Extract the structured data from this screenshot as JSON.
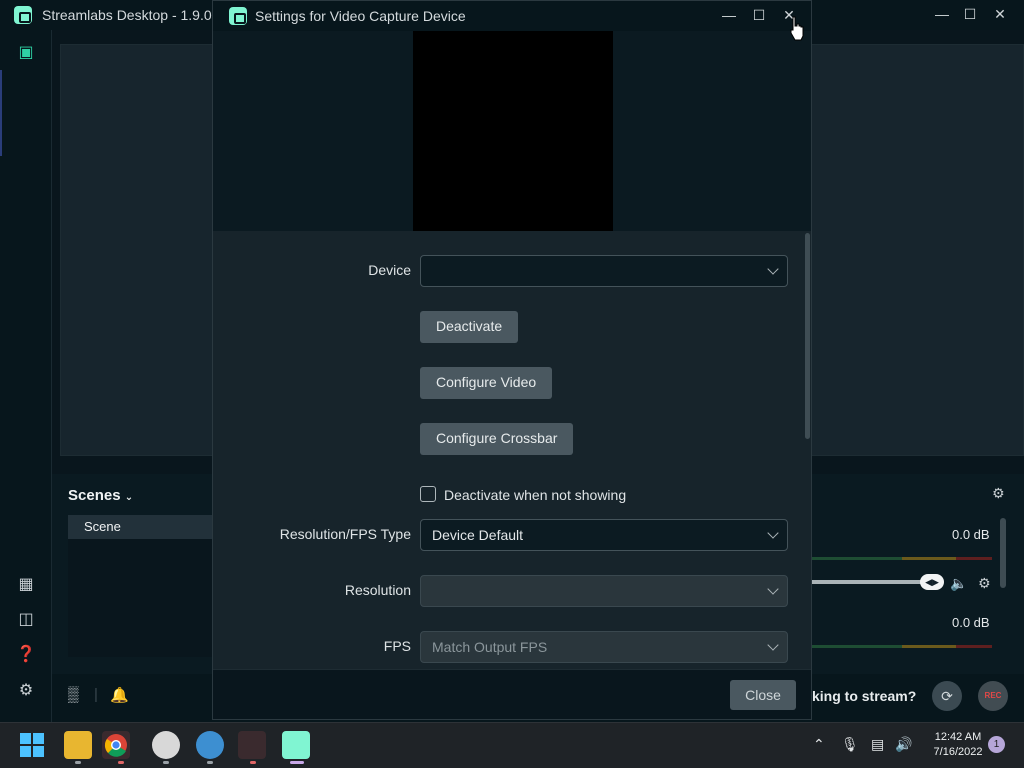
{
  "main_window": {
    "title": "Streamlabs Desktop - 1.9.0",
    "scenes_title": "Scenes",
    "scene_items": [
      "Scene"
    ],
    "mixer_values": [
      "0.0 dB",
      "0.0 dB"
    ],
    "stream_prompt": "king to stream?",
    "rec_label": "REC"
  },
  "dialog": {
    "title": "Settings for Video Capture Device",
    "fields": {
      "device_label": "Device",
      "device_value": "",
      "deactivate_button": "Deactivate",
      "configure_video_button": "Configure Video",
      "configure_crossbar_button": "Configure Crossbar",
      "deactivate_checkbox_label": "Deactivate when not showing",
      "deactivate_checkbox_checked": false,
      "resolution_fps_type_label": "Resolution/FPS Type",
      "resolution_fps_type_value": "Device Default",
      "resolution_label": "Resolution",
      "resolution_value": "",
      "fps_label": "FPS",
      "fps_value": "Match Output FPS"
    },
    "close_button": "Close"
  },
  "taskbar": {
    "time": "12:42 AM",
    "date": "7/16/2022",
    "notification_count": "1"
  },
  "colors": {
    "app_accent": "#80f5d2",
    "background": "#09161d",
    "button": "#4a5860"
  }
}
